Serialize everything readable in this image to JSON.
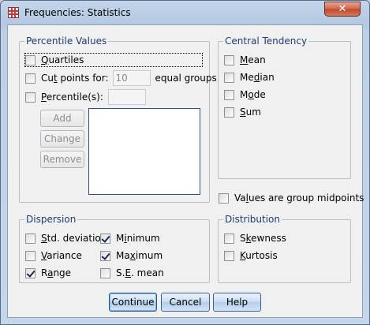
{
  "window": {
    "title": "Frequencies: Statistics",
    "close_symbol": "✕"
  },
  "percentile_values": {
    "legend": "Percentile Values",
    "quartiles": {
      "label": "Quartiles",
      "underline": "Q",
      "checked": false
    },
    "cut_points": {
      "label_pre": "Cu",
      "underline": "t",
      "label_post": " points for:",
      "value": "10",
      "suffix": "equal groups",
      "checked": false
    },
    "percentiles": {
      "label": "Percentile(s):",
      "underline": "P",
      "checked": false,
      "value": ""
    },
    "buttons": {
      "add": "Add",
      "change": "Change",
      "remove": "Remove"
    }
  },
  "central_tendency": {
    "legend": "Central Tendency",
    "items": [
      {
        "label": "Mean",
        "underline": "M",
        "checked": false
      },
      {
        "label": "Median",
        "underline": "d",
        "checked": false
      },
      {
        "label": "Mode",
        "underline": "o",
        "checked": false
      },
      {
        "label": "Sum",
        "underline": "S",
        "checked": false
      }
    ]
  },
  "group_midpoints": {
    "label": "Values are group midpoints",
    "underline": "l",
    "checked": false
  },
  "dispersion": {
    "legend": "Dispersion",
    "std_deviation": {
      "label": "Std. deviation",
      "checked": false
    },
    "variance": {
      "label": "Variance",
      "checked": false
    },
    "range": {
      "label": "Range",
      "checked": true
    },
    "minimum": {
      "label": "Minimum",
      "checked": true
    },
    "maximum": {
      "label": "Maximum",
      "checked": true
    },
    "se_mean": {
      "label": "S.E. mean",
      "checked": false
    }
  },
  "distribution": {
    "legend": "Distribution",
    "skewness": {
      "label": "Skewness",
      "checked": false
    },
    "kurtosis": {
      "label": "Kurtosis",
      "checked": false
    }
  },
  "footer": {
    "continue": "Continue",
    "cancel": "Cancel",
    "help": "Help"
  },
  "colors": {
    "legend_text": "#1f3c6e",
    "disabled_text": "#8e8f8f",
    "listbox_border": "#2f4f85"
  }
}
